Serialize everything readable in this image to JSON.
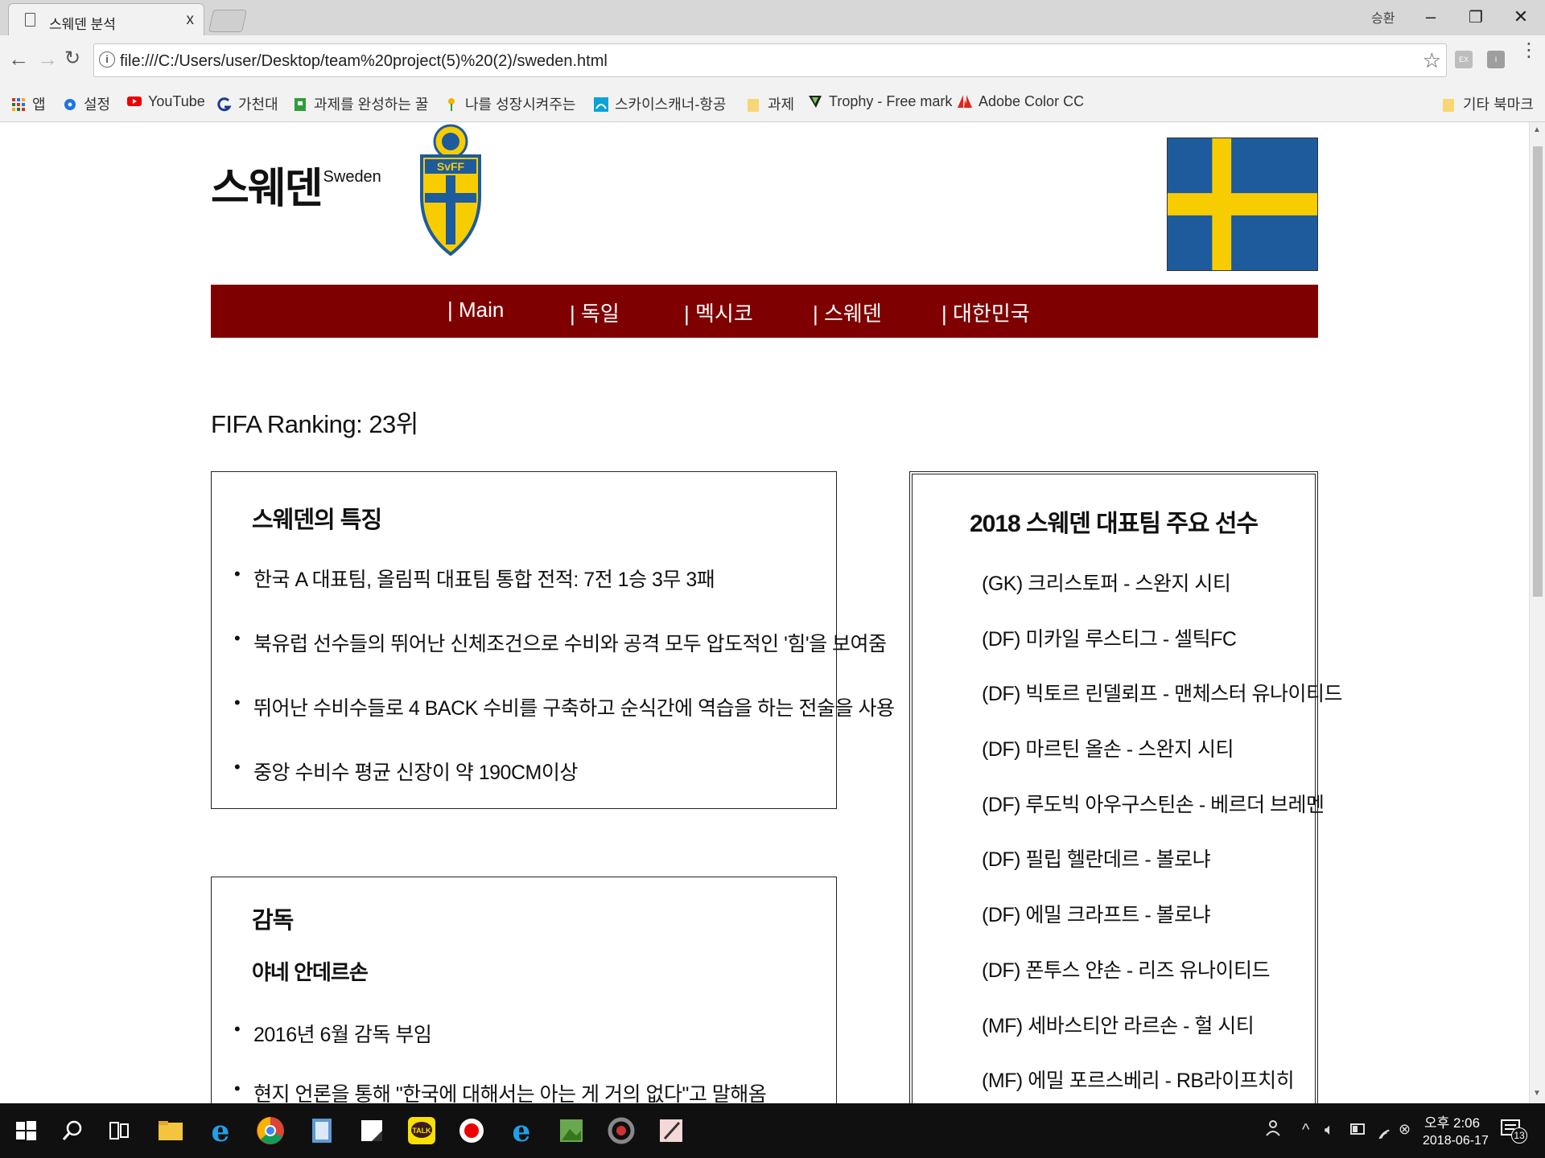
{
  "browser": {
    "tab_title": "스웨덴 분석",
    "tab_close": "x",
    "user_label": "승환",
    "url": "file:///C:/Users/user/Desktop/team%20project(5)%20(2)/sweden.html",
    "bookmarks": [
      "앱",
      "설정",
      "YouTube",
      "가천대",
      "과제를 완성하는 꿀",
      "나를 성장시켜주는",
      "스카이스캐너-항공",
      "과제",
      "Trophy - Free mark",
      "Adobe Color CC"
    ],
    "other_bookmarks": "기타 북마크",
    "extensions": [
      "EX",
      "I"
    ]
  },
  "page": {
    "title": "스웨덴",
    "title_sup": "Sweden",
    "crest_text": "SvFF",
    "nav": [
      "| Main",
      "| 독일",
      "| 멕시코",
      "| 스웨덴",
      "| 대한민국"
    ],
    "fifa_ranking": "FIFA Ranking: 23위",
    "features": {
      "heading": "스웨덴의 특징",
      "items": [
        "한국 A 대표팀, 올림픽 대표팀 통합 전적: 7전 1승 3무 3패",
        "북유럽 선수들의 뛰어난 신체조건으로 수비와 공격 모두 압도적인 '힘'을 보여줌",
        "뛰어난 수비수들로 4 BACK 수비를 구축하고 순식간에 역습을 하는 전술을 사용",
        "중앙 수비수 평균 신장이 약 190CM이상"
      ]
    },
    "coach": {
      "heading": "감독",
      "name": "야네 안데르손",
      "items": [
        "2016년 6월 감독 부임",
        "현지 언론을 통해 \"한국에 대해서는 아는 게 거의 없다\"고 말해옴"
      ]
    },
    "players": {
      "heading": "2018 스웨덴 대표팀 주요 선수",
      "items": [
        "(GK) 크리스토퍼 - 스완지 시티",
        "(DF) 미카일 루스티그 - 셀틱FC",
        "(DF) 빅토르 린델뢰프 - 맨체스터 유나이티드",
        "(DF) 마르틴 올손 - 스완지 시티",
        "(DF) 루도빅 아우구스틴손 - 베르더 브레멘",
        "(DF) 필립 헬란데르 - 볼로냐",
        "(DF) 에밀 크라프트 - 볼로냐",
        "(DF) 폰투스 얀손 - 리즈 유나이티드",
        "(MF) 세바스티안 라르손 - 헐 시티",
        "(MF) 에밀 포르스베리 - RB라이프치히"
      ]
    }
  },
  "taskbar": {
    "time": "오후 2:06",
    "date": "2018-06-17",
    "notification_count": "13",
    "kakao_label": "TALK"
  },
  "colors": {
    "nav_bg": "#7f0000",
    "flag_blue": "#1e5b9c",
    "flag_yellow": "#f8cd00"
  }
}
